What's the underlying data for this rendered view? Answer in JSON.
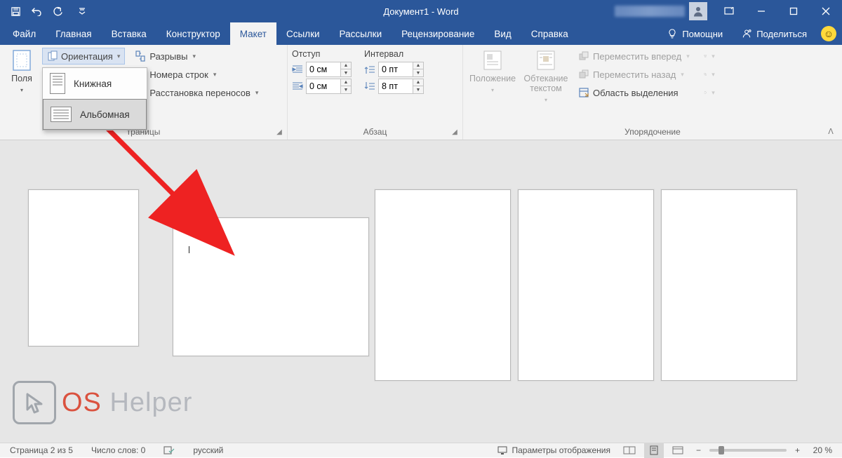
{
  "title": "Документ1  -  Word",
  "tabs": [
    "Файл",
    "Главная",
    "Вставка",
    "Конструктор",
    "Макет",
    "Ссылки",
    "Рассылки",
    "Рецензирование",
    "Вид",
    "Справка"
  ],
  "active_tab": 4,
  "tell_me": "Помощни",
  "share": "Поделиться",
  "ribbon": {
    "margins": "Поля",
    "orientation_label": "Ориентация",
    "orientation_menu": {
      "portrait": "Книжная",
      "landscape": "Альбомная"
    },
    "breaks": "Разрывы",
    "line_numbers": "Номера строк",
    "hyphenation": "Расстановка переносов",
    "page_setup_label": "траницы",
    "indent_header": "Отступ",
    "spacing_header": "Интервал",
    "indent_left": "0 см",
    "indent_right": "0 см",
    "space_before": "0 пт",
    "space_after": "8 пт",
    "paragraph_label": "Абзац",
    "position": "Положение",
    "wrap": "Обтекание текстом",
    "bring_forward": "Переместить вперед",
    "send_backward": "Переместить назад",
    "selection_pane": "Область выделения",
    "arrange_label": "Упорядочение"
  },
  "status": {
    "page": "Страница 2 из 5",
    "words": "Число слов: 0",
    "lang": "русский",
    "display_settings": "Параметры отображения",
    "zoom": "20 %"
  },
  "watermark": {
    "os": "OS",
    "helper": " Helper"
  }
}
